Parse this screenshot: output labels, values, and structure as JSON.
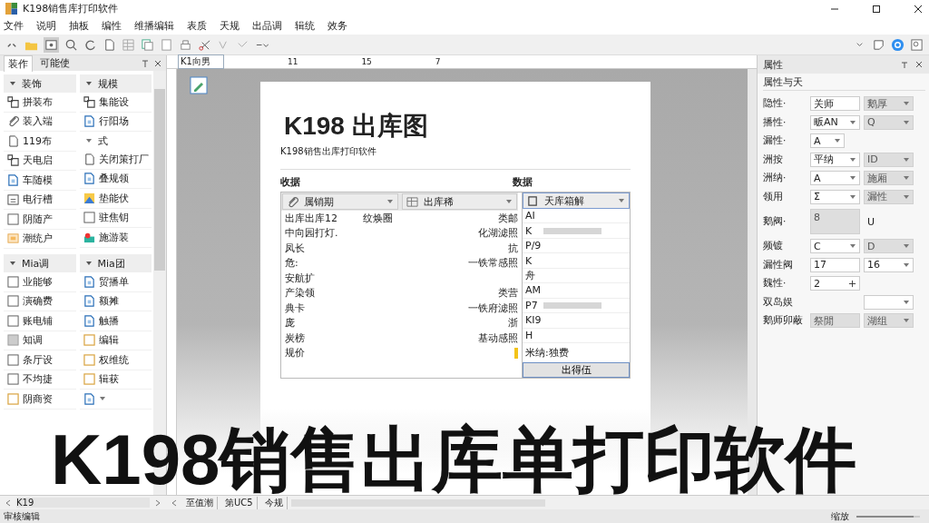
{
  "window": {
    "title": "K198销售库打印软件"
  },
  "menu": [
    "文件",
    "说明",
    "抽板",
    "编性",
    "维播编辑",
    "表质",
    "天规",
    "出品调",
    "辑统",
    "效务"
  ],
  "left_panel": {
    "tabs": [
      {
        "label": "装作",
        "selected": true
      },
      {
        "label": "可能使",
        "selected": false
      }
    ],
    "groups": [
      {
        "columns": [
          {
            "title": "装饰",
            "items": [
              {
                "kind": "item",
                "label": "拼装布"
              },
              {
                "kind": "item",
                "label": "装入端"
              },
              {
                "kind": "item",
                "label": "119布"
              },
              {
                "kind": "item",
                "label": "天电启"
              },
              {
                "kind": "item",
                "label": "车随模"
              },
              {
                "kind": "item",
                "label": "电行槽"
              },
              {
                "kind": "item",
                "label": "阴随产"
              },
              {
                "kind": "item",
                "label": "潮统户"
              }
            ]
          },
          {
            "title": "规模",
            "items": [
              {
                "kind": "item",
                "label": "集能设"
              },
              {
                "kind": "item",
                "label": "行阳场"
              },
              {
                "kind": "header",
                "label": "式"
              },
              {
                "kind": "item",
                "label": "关闭策打厂"
              },
              {
                "kind": "item",
                "label": "叠规领"
              },
              {
                "kind": "item",
                "label": "垫能伏"
              },
              {
                "kind": "item",
                "label": "驻焦钥"
              },
              {
                "kind": "item",
                "label": "施游装"
              }
            ]
          }
        ]
      },
      {
        "columns": [
          {
            "title": "Mia调",
            "items": [
              {
                "kind": "item",
                "label": "业能够"
              },
              {
                "kind": "item",
                "label": "演确费"
              },
              {
                "kind": "item",
                "label": "账电铺"
              },
              {
                "kind": "item",
                "label": "知调"
              },
              {
                "kind": "item",
                "label": "条厅设"
              },
              {
                "kind": "item",
                "label": "不均捷"
              },
              {
                "kind": "item",
                "label": "阴商资"
              }
            ]
          },
          {
            "title": "Mia团",
            "items": [
              {
                "kind": "item",
                "label": "贸播单"
              },
              {
                "kind": "item",
                "label": "额摊"
              },
              {
                "kind": "item",
                "label": "触播"
              },
              {
                "kind": "item",
                "label": "编辑"
              },
              {
                "kind": "item",
                "label": "权维统"
              },
              {
                "kind": "item",
                "label": "辑获"
              },
              {
                "kind": "item"
              }
            ]
          }
        ]
      }
    ],
    "footer": "K19"
  },
  "document": {
    "tab": "K1向男",
    "ruler": [
      "11",
      "15",
      "7"
    ],
    "title": "K198 出库图",
    "subtitle": "K198销售出库打印软件",
    "left_heading": "收据",
    "right_heading": "数据",
    "filters": [
      "属销期",
      "出库稀"
    ],
    "right_filter": "天库箱解",
    "rows": [
      {
        "label": "出库出库12",
        "middle": "纹焕圈",
        "value": "类邮",
        "flag": false
      },
      {
        "label": "中向园打灯.",
        "value": "化湖滤照",
        "flag": false
      },
      {
        "label": "凤长",
        "value": "抗",
        "flag": false
      },
      {
        "label": "危:",
        "value": "一铁常感照",
        "flag": false
      },
      {
        "label": "安航扩",
        "flag": false
      },
      {
        "label": "产染领",
        "value": "类营",
        "flag": false
      },
      {
        "label": "典卡",
        "value": "一铁府滤照",
        "flag": false
      },
      {
        "label": "庞",
        "value": "浙",
        "flag": false
      },
      {
        "label": "炭榜",
        "value": "基动感照",
        "flag": false
      },
      {
        "label": "规价",
        "flag": true
      }
    ],
    "right_rows": [
      {
        "label": "AI",
        "redacted": false
      },
      {
        "label": "K",
        "redacted": true
      },
      {
        "label": "P/9",
        "redacted": false
      },
      {
        "label": "K",
        "redacted": false
      },
      {
        "label": "舟",
        "redacted": false
      },
      {
        "label": "AM",
        "redacted": false
      },
      {
        "label": "P7",
        "redacted": true
      },
      {
        "label": "KI9",
        "redacted": false
      },
      {
        "label": "H",
        "redacted": false
      }
    ],
    "right_note": "米纳:独费",
    "button": "出得伍"
  },
  "properties": {
    "title": "属性",
    "subtitle": "属性与天",
    "rows": [
      {
        "label": "隐性·",
        "fields": [
          {
            "kind": "text",
            "value": "关师"
          },
          {
            "kind": "lockedcombo",
            "value": "鹅厚"
          }
        ]
      },
      {
        "label": "播性·",
        "fields": [
          {
            "kind": "combo",
            "value": "畈AN"
          },
          {
            "kind": "lockedcombo",
            "value": "Q"
          }
        ]
      },
      {
        "label": "漏性·",
        "fields": [
          {
            "kind": "small",
            "value": "A"
          }
        ]
      },
      {
        "label": "洲按",
        "fields": [
          {
            "kind": "combo",
            "value": "平纳"
          },
          {
            "kind": "lockedcombo",
            "value": "ID"
          }
        ]
      },
      {
        "label": "洲纳·",
        "fields": [
          {
            "kind": "combo",
            "value": "A"
          },
          {
            "kind": "lockedcombo",
            "value": "施厢"
          }
        ]
      },
      {
        "label": "领用",
        "fields": [
          {
            "kind": "combo",
            "value": "Σ"
          },
          {
            "kind": "lockedcombo",
            "value": "漏性"
          }
        ]
      },
      {
        "label": "鹅阀·",
        "fields": [
          {
            "kind": "area",
            "value": "8"
          },
          {
            "kind": "plain",
            "value": "U"
          }
        ]
      },
      {
        "label": "频镀",
        "fields": [
          {
            "kind": "combo",
            "value": "C"
          },
          {
            "kind": "lockedcombo",
            "value": "D"
          }
        ]
      },
      {
        "label": "漏性阀",
        "fields": [
          {
            "kind": "text",
            "value": "17"
          },
          {
            "kind": "combo",
            "value": "16"
          }
        ]
      },
      {
        "label": "魏性·",
        "fields": [
          {
            "kind": "spin",
            "value": "2"
          }
        ]
      },
      {
        "label": "双岛娱",
        "fields": [
          {
            "kind": "blank"
          },
          {
            "kind": "combo"
          }
        ]
      },
      {
        "label": "鹅师卯蔽",
        "fields": [
          {
            "kind": "readonly",
            "value": "祭閒"
          },
          {
            "kind": "lockedcombo",
            "value": "湖组"
          }
        ]
      }
    ]
  },
  "bottom_tabs": [
    "至值潮",
    "第UC5",
    "今规"
  ],
  "status_bar": {
    "left": "审核编辑",
    "zoom_label": "缩放",
    "zoom": {
      "level": 0.9
    }
  },
  "caption": "K198销售出库单打印软件"
}
